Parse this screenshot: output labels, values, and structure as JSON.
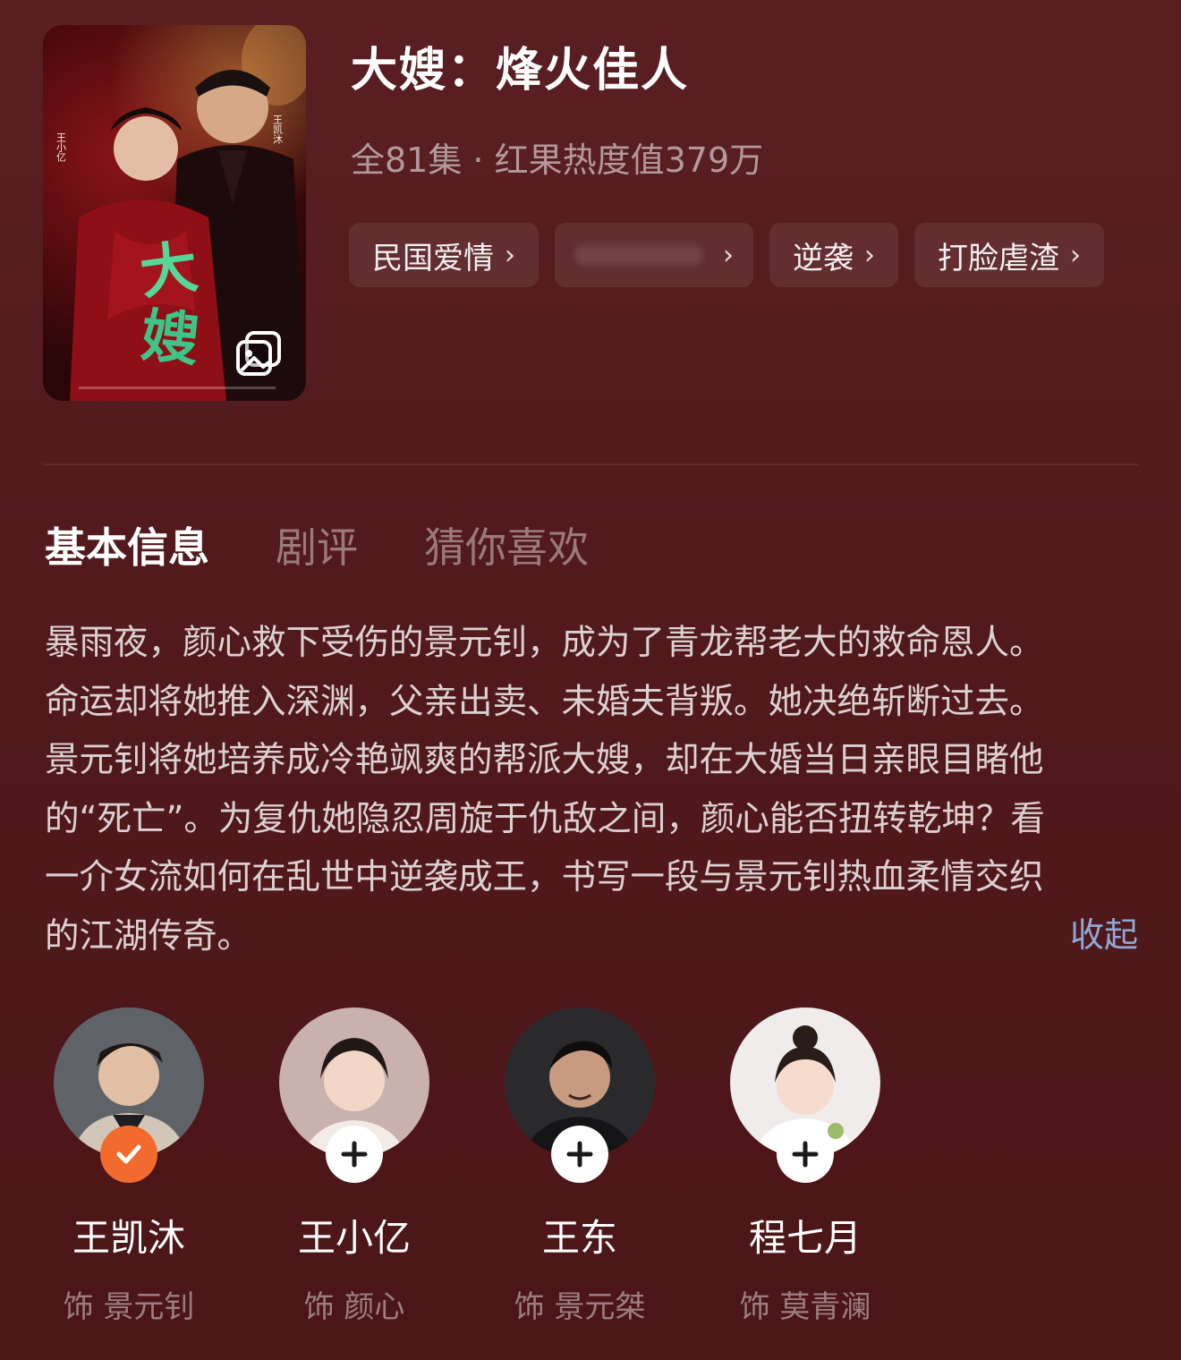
{
  "show": {
    "title": "大嫂：烽火佳人",
    "meta": "全81集 · 红果热度值379万",
    "tags": [
      "民国爱情",
      "逆袭",
      "打脸虐渣"
    ]
  },
  "tabs": [
    "基本信息",
    "剧评",
    "猜你喜欢"
  ],
  "synopsis": {
    "lines": [
      "暴雨夜，颜心救下受伤的景元钊，成为了青龙帮老大的救命恩人。",
      "命运却将她推入深渊，父亲出卖、未婚夫背叛。她决绝斩断过去。",
      "景元钊将她培养成冷艳飒爽的帮派大嫂，却在大婚当日亲眼目睹他",
      "的“死亡”。为复仇她隐忍周旋于仇敌之间，颜心能否扭转乾坤？看",
      "一介女流如何在乱世中逆袭成王，书写一段与景元钊热血柔情交织",
      "的江湖传奇。"
    ],
    "collapse_label": "收起"
  },
  "cast": [
    {
      "name": "王凯沐",
      "role": "饰 景元钊",
      "followed": true
    },
    {
      "name": "王小亿",
      "role": "饰 颜心",
      "followed": false
    },
    {
      "name": "王东",
      "role": "饰 景元桀",
      "followed": false
    },
    {
      "name": "程七月",
      "role": "饰 莫青澜",
      "followed": false
    }
  ],
  "colors": {
    "background": "#521a1d",
    "accent_orange": "#f26a2e",
    "link_blue": "#8fa9d6"
  },
  "icons": {
    "gallery": "image-gallery-icon",
    "tag_chevron": "chevron-right-icon",
    "followed_badge": "checkmark-icon",
    "follow_badge": "plus-icon"
  }
}
